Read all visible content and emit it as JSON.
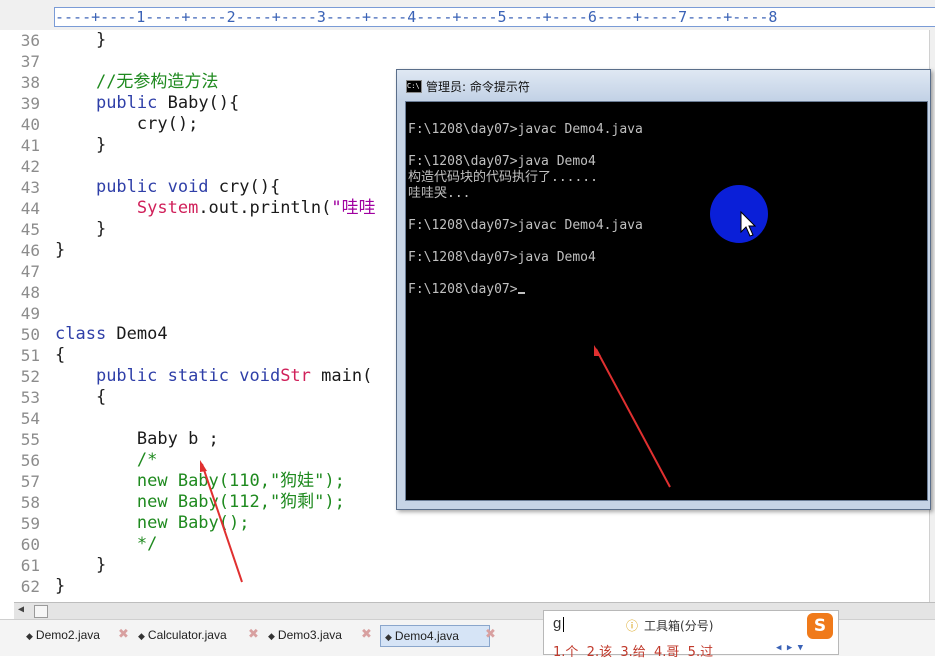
{
  "ruler": {
    "text": "----+----1----+----2----+----3----+----4----+----5----+----6----+----7----+----8"
  },
  "editor": {
    "line_numbers": [
      "36",
      "37",
      "38",
      "39",
      "40",
      "41",
      "42",
      "43",
      "44",
      "45",
      "46",
      "47",
      "48",
      "49",
      "50",
      "51",
      "52",
      "53",
      "54",
      "55",
      "56",
      "57",
      "58",
      "59",
      "60",
      "61",
      "62"
    ],
    "lines": [
      {
        "ind": "    ",
        "t": "}"
      },
      {
        "ind": "",
        "t": ""
      },
      {
        "ind": "    ",
        "comment": "//无参构造方法"
      },
      {
        "ind": "    ",
        "kw": "public",
        "t": " Baby(){"
      },
      {
        "ind": "        ",
        "t": "cry();"
      },
      {
        "ind": "    ",
        "t": "}"
      },
      {
        "ind": "",
        "t": ""
      },
      {
        "ind": "    ",
        "kw": "public void",
        "t": " cry(){"
      },
      {
        "ind": "        ",
        "sys": "System",
        "t": ".out.println(",
        "str": "\"哇哇"
      },
      {
        "ind": "    ",
        "t": "}"
      },
      {
        "ind": "",
        "t": "}"
      },
      {
        "ind": "",
        "t": ""
      },
      {
        "ind": "",
        "t": ""
      },
      {
        "ind": "",
        "t": ""
      },
      {
        "ind": "",
        "kw": "class",
        "t": " Demo4"
      },
      {
        "ind": "",
        "t": "{"
      },
      {
        "ind": "    ",
        "kw": "public static void",
        "t": " main(",
        "sys": "Str"
      },
      {
        "ind": "    ",
        "t": "{"
      },
      {
        "ind": "",
        "t": ""
      },
      {
        "ind": "        ",
        "t": "Baby b ;"
      },
      {
        "ind": "        ",
        "comment": "/*"
      },
      {
        "ind": "        ",
        "comment": "new Baby(110,\"狗娃\");"
      },
      {
        "ind": "        ",
        "comment": "new Baby(112,\"狗剩\");"
      },
      {
        "ind": "        ",
        "comment": "new Baby();"
      },
      {
        "ind": "        ",
        "comment": "*/"
      },
      {
        "ind": "    ",
        "t": "}"
      },
      {
        "ind": "",
        "t": "}"
      }
    ]
  },
  "console": {
    "title": "管理员: 命令提示符",
    "icon": "C:\\",
    "lines": [
      "",
      "F:\\1208\\day07>javac Demo4.java",
      "",
      "F:\\1208\\day07>java Demo4",
      "构造代码块的代码执行了......",
      "哇哇哭...",
      "",
      "F:\\1208\\day07>javac Demo4.java",
      "",
      "F:\\1208\\day07>java Demo4",
      "",
      "F:\\1208\\day07>"
    ]
  },
  "tabs": [
    {
      "label": "Demo2.java",
      "active": false
    },
    {
      "label": "Calculator.java",
      "active": false
    },
    {
      "label": "Demo3.java",
      "active": false
    },
    {
      "label": "Demo4.java",
      "active": true
    }
  ],
  "ime": {
    "input": "g",
    "toolbox": "工具箱(分号)",
    "candidates": "1.个  2.该  3.给  4.哥  5.过",
    "logo": "S"
  },
  "colors": {
    "keyword": "#2f3fa8",
    "comment": "#1f8a1f",
    "system_class": "#d0205a",
    "string": "#a000a0",
    "annotation_arrow": "#e03030",
    "cursor_highlight": "#0a1fd8"
  }
}
